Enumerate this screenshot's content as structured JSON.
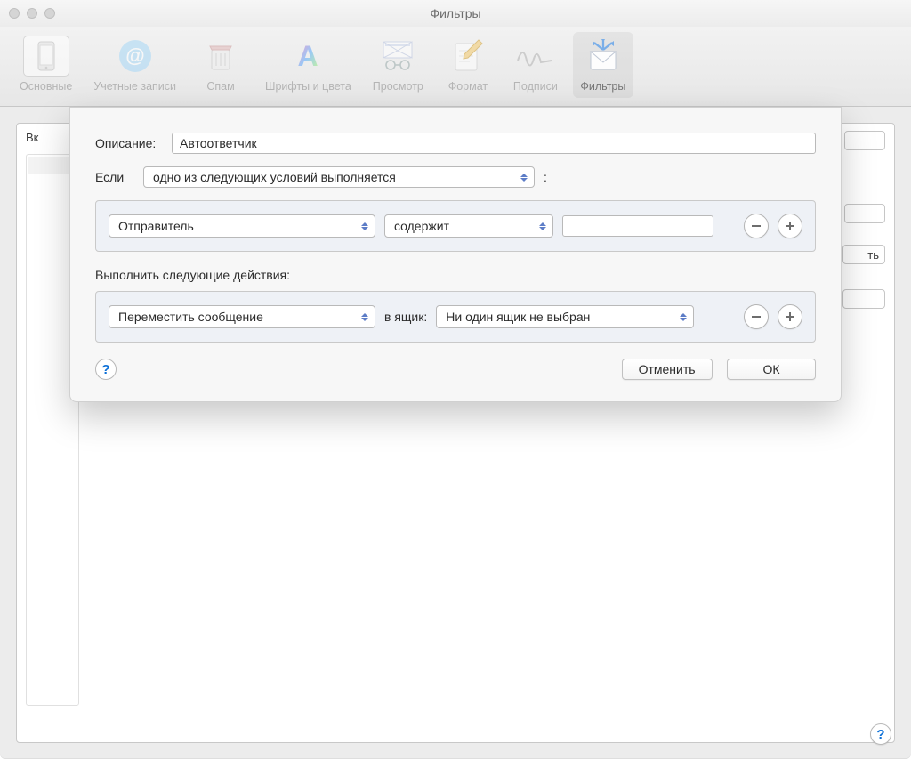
{
  "title": "Фильтры",
  "toolbar": {
    "items": [
      {
        "label": "Основные"
      },
      {
        "label": "Учетные записи"
      },
      {
        "label": "Спам"
      },
      {
        "label": "Шрифты и цвета"
      },
      {
        "label": "Просмотр"
      },
      {
        "label": "Формат"
      },
      {
        "label": "Подписи"
      },
      {
        "label": "Фильтры"
      }
    ]
  },
  "leftColumnHeader": "Вк",
  "rightStubText": "ть",
  "sheet": {
    "descriptionLabel": "Описание:",
    "descriptionValue": "Автоответчик",
    "ifLabel": "Если",
    "conditionScope": "одно из следующих условий выполняется",
    "colon": ":",
    "condition": {
      "field": "Отправитель",
      "operator": "содержит",
      "value": ""
    },
    "actionsLabel": "Выполнить следующие действия:",
    "action": {
      "type": "Переместить сообщение",
      "toLabel": "в ящик:",
      "target": "Ни один ящик не выбран"
    },
    "cancel": "Отменить",
    "ok": "ОК"
  },
  "helpGlyph": "?"
}
